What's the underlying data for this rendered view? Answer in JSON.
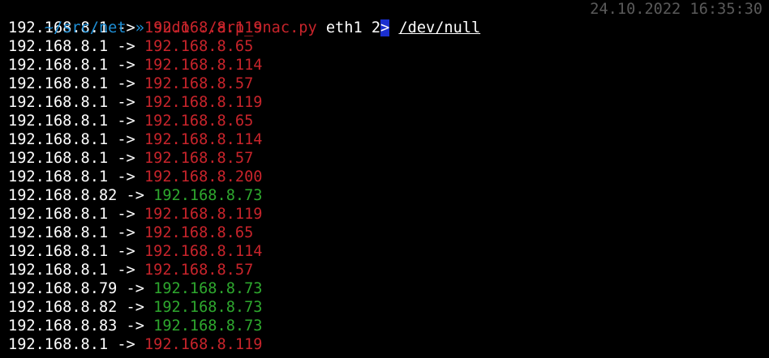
{
  "colors": {
    "background": "#000000",
    "cwd": "#1e8fd6",
    "command": "#c8242b",
    "timestamp": "#5a5a5a",
    "cursor": "#1a2fd0",
    "dest_red": "#c8242b",
    "dest_green": "#2ea82e",
    "text": "#ffffff"
  },
  "prompt": {
    "cwd": "~/src/net",
    "arrow": "»",
    "command": "sudo",
    "script": "./arp_snac.py",
    "arg": "eth1",
    "fd": "2",
    "cursor_char": ">",
    "target": "/dev/null",
    "timestamp": "24.10.2022 16:35:30"
  },
  "output": [
    {
      "src": "192.168.8.1",
      "sep": "->",
      "dst": "192.168.8.119",
      "color": "red"
    },
    {
      "src": "192.168.8.1",
      "sep": "->",
      "dst": "192.168.8.65",
      "color": "red"
    },
    {
      "src": "192.168.8.1",
      "sep": "->",
      "dst": "192.168.8.114",
      "color": "red"
    },
    {
      "src": "192.168.8.1",
      "sep": "->",
      "dst": "192.168.8.57",
      "color": "red"
    },
    {
      "src": "192.168.8.1",
      "sep": "->",
      "dst": "192.168.8.119",
      "color": "red"
    },
    {
      "src": "192.168.8.1",
      "sep": "->",
      "dst": "192.168.8.65",
      "color": "red"
    },
    {
      "src": "192.168.8.1",
      "sep": "->",
      "dst": "192.168.8.114",
      "color": "red"
    },
    {
      "src": "192.168.8.1",
      "sep": "->",
      "dst": "192.168.8.57",
      "color": "red"
    },
    {
      "src": "192.168.8.1",
      "sep": "->",
      "dst": "192.168.8.200",
      "color": "red"
    },
    {
      "src": "192.168.8.82",
      "sep": "->",
      "dst": "192.168.8.73",
      "color": "green"
    },
    {
      "src": "192.168.8.1",
      "sep": "->",
      "dst": "192.168.8.119",
      "color": "red"
    },
    {
      "src": "192.168.8.1",
      "sep": "->",
      "dst": "192.168.8.65",
      "color": "red"
    },
    {
      "src": "192.168.8.1",
      "sep": "->",
      "dst": "192.168.8.114",
      "color": "red"
    },
    {
      "src": "192.168.8.1",
      "sep": "->",
      "dst": "192.168.8.57",
      "color": "red"
    },
    {
      "src": "192.168.8.79",
      "sep": "->",
      "dst": "192.168.8.73",
      "color": "green"
    },
    {
      "src": "192.168.8.82",
      "sep": "->",
      "dst": "192.168.8.73",
      "color": "green"
    },
    {
      "src": "192.168.8.83",
      "sep": "->",
      "dst": "192.168.8.73",
      "color": "green"
    },
    {
      "src": "192.168.8.1",
      "sep": "->",
      "dst": "192.168.8.119",
      "color": "red"
    }
  ]
}
